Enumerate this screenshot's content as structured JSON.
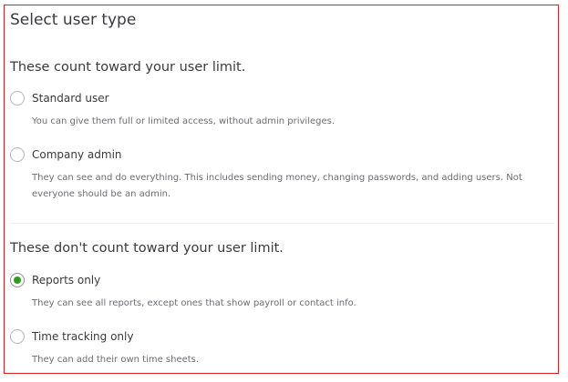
{
  "title": "Select user type",
  "sections": [
    {
      "heading": "These count toward your user limit.",
      "options": [
        {
          "label": "Standard user",
          "description": "You can give them full or limited access, without admin privileges.",
          "selected": false
        },
        {
          "label": "Company admin",
          "description": "They can see and do everything. This includes sending money, changing passwords, and adding users. Not everyone should be an admin.",
          "selected": false
        }
      ]
    },
    {
      "heading": "These don't count toward your user limit.",
      "options": [
        {
          "label": "Reports only",
          "description": "They can see all reports, except ones that show payroll or contact info.",
          "selected": true
        },
        {
          "label": "Time tracking only",
          "description": "They can add their own time sheets.",
          "selected": false
        }
      ]
    }
  ],
  "colors": {
    "selected_radio": "#2ca01c",
    "frame_border": "#e02020"
  }
}
